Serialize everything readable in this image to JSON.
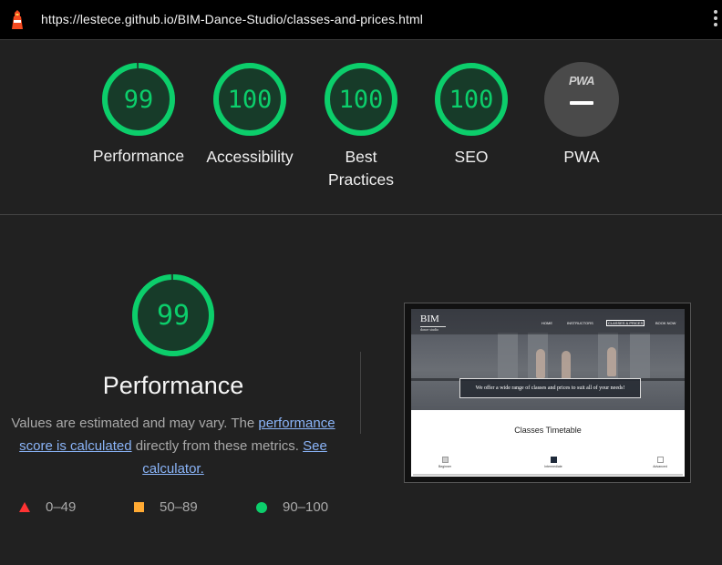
{
  "topbar": {
    "url": "https://lestece.github.io/BIM-Dance-Studio/classes-and-prices.html",
    "icon": "lighthouse-icon",
    "menu_icon": "kebab-menu-icon"
  },
  "gauges": [
    {
      "score": "99",
      "label": "Performance",
      "fraction": 0.99
    },
    {
      "score": "100",
      "label": "Accessibility",
      "fraction": 1.0
    },
    {
      "score": "100",
      "label_line1": "Best",
      "label_line2": "Practices",
      "fraction": 1.0
    },
    {
      "score": "100",
      "label": "SEO",
      "fraction": 1.0
    }
  ],
  "pwa": {
    "badge": "PWA",
    "label": "PWA"
  },
  "performance": {
    "score": "99",
    "fraction": 0.99,
    "title": "Performance",
    "desc_part1": "Values are estimated and may vary. The ",
    "desc_link1": "performance score is calculated",
    "desc_part2": " directly from these metrics. ",
    "desc_link2": "See calculator."
  },
  "legend": {
    "fail": "0–49",
    "average": "50–89",
    "pass": "90–100"
  },
  "thumbnail": {
    "logo": "BIM",
    "logo_sub": "dance studio",
    "nav": [
      "HOME",
      "INSTRUCTORS",
      "CLASSES & PRICES",
      "BOOK NOW"
    ],
    "offer": "We offer a wide range of classes and prices to suit all of your needs!",
    "timetable_title": "Classes Timetable",
    "levels": [
      "Beginner",
      "Intermediate",
      "Advanced"
    ]
  },
  "colors": {
    "pass": "#0cce6b",
    "average": "#ffaa33",
    "fail": "#ff3333",
    "link": "#8ab4f8",
    "background": "#212121"
  }
}
